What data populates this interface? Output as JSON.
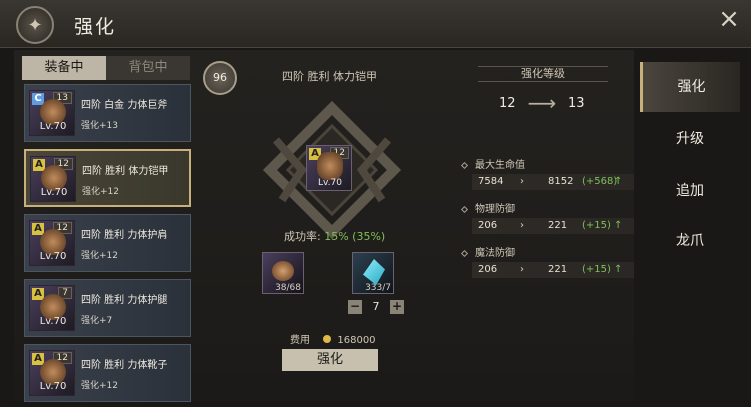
{
  "header": {
    "title": "强化",
    "close_icon": "×",
    "emblem_icon": "✦"
  },
  "left_tabs": [
    {
      "label": "装备中",
      "active": true
    },
    {
      "label": "背包中",
      "active": false
    }
  ],
  "items": [
    {
      "tier": "C",
      "level_badge": "13",
      "lv": "Lv.70",
      "name": "四阶 白金 力体巨斧",
      "enh": "强化+13",
      "selected": false
    },
    {
      "tier": "A",
      "level_badge": "12",
      "lv": "Lv.70",
      "name": "四阶 胜利 体力铠甲",
      "enh": "强化+12",
      "selected": true
    },
    {
      "tier": "A",
      "level_badge": "12",
      "lv": "Lv.70",
      "name": "四阶 胜利 力体护肩",
      "enh": "强化+12",
      "selected": false
    },
    {
      "tier": "A",
      "level_badge": "7",
      "lv": "Lv.70",
      "name": "四阶 胜利 力体护腿",
      "enh": "强化+7",
      "selected": false
    },
    {
      "tier": "A",
      "level_badge": "12",
      "lv": "Lv.70",
      "name": "四阶 胜利 力体靴子",
      "enh": "强化+12",
      "selected": false
    }
  ],
  "center": {
    "badge": "96",
    "item_title": "四阶 胜利 体力铠甲",
    "icon_tier": "A",
    "icon_level": "12",
    "icon_lv": "Lv.70",
    "success_label": "成功率:",
    "success_value": "15%",
    "success_paren": "(35%)",
    "materials": [
      {
        "count": "38/68"
      },
      {
        "count": "333/7"
      }
    ],
    "stepper_value": "7",
    "stepper_minus": "−",
    "stepper_plus": "+",
    "cost_label": "费用",
    "cost_value": "168000",
    "button_label": "强化"
  },
  "stats": {
    "header": "强化等级",
    "from": "12",
    "to": "13",
    "arrow": "⟶",
    "rows": [
      {
        "name": "最大生命值",
        "from": "7584",
        "arrow": "›",
        "to": "8152",
        "delta": "(+568)",
        "up": "↑"
      },
      {
        "name": "物理防御",
        "from": "206",
        "arrow": "›",
        "to": "221",
        "delta": "(+15)",
        "up": "↑"
      },
      {
        "name": "魔法防御",
        "from": "206",
        "arrow": "›",
        "to": "221",
        "delta": "(+15)",
        "up": "↑"
      }
    ]
  },
  "nav": [
    {
      "label": "强化",
      "active": true
    },
    {
      "label": "升级",
      "active": false
    },
    {
      "label": "追加",
      "active": false
    },
    {
      "label": "龙爪",
      "active": false
    }
  ]
}
